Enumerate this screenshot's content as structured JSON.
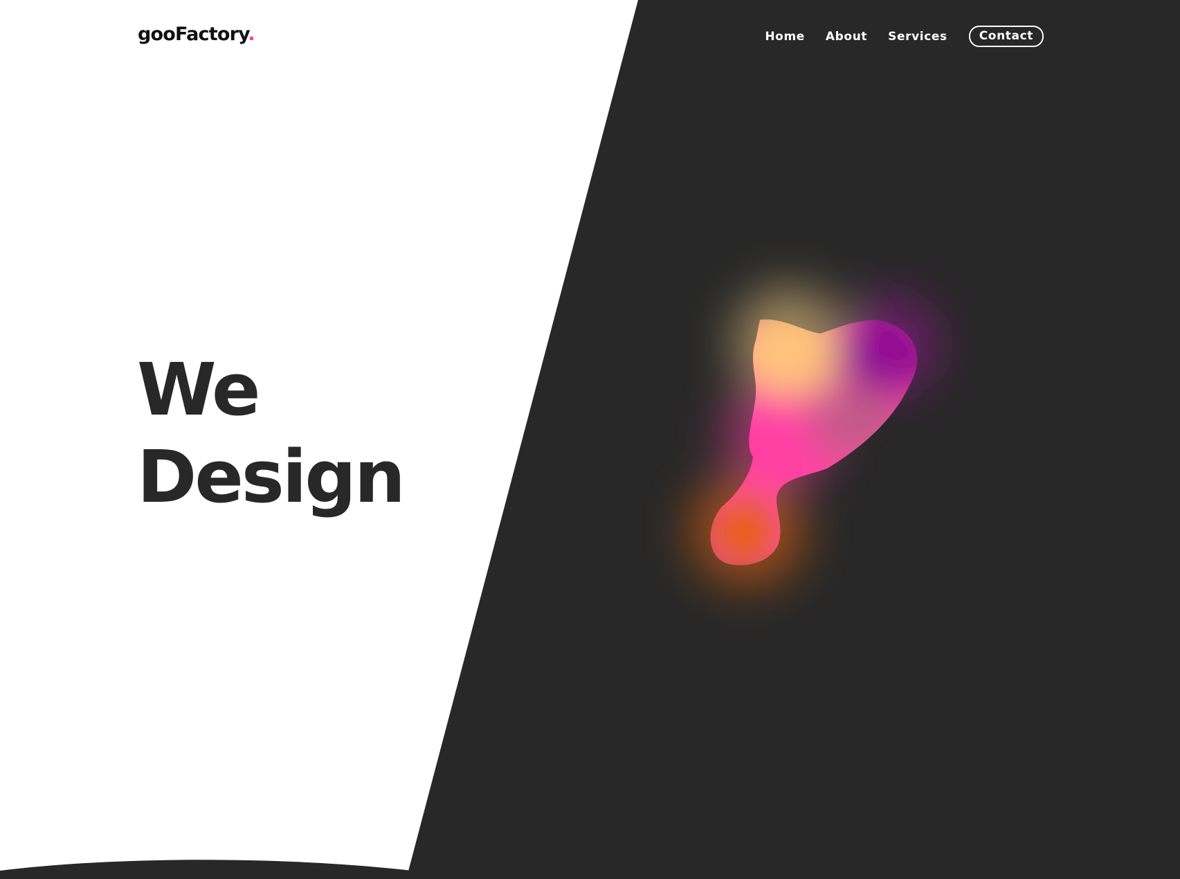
{
  "brand": {
    "name": "gooFactory",
    "dot": ".",
    "accent_color": "#ff3d8f"
  },
  "nav": {
    "items": [
      "Home",
      "About",
      "Services"
    ],
    "cta": "Contact"
  },
  "hero": {
    "line1": "We",
    "line2": "Design"
  },
  "theme": {
    "dark_panel": "#282828",
    "light_panel": "#ffffff",
    "blob_colors": [
      "#ffc07a",
      "#ff3fa5",
      "#930a94",
      "#e85e05"
    ]
  }
}
